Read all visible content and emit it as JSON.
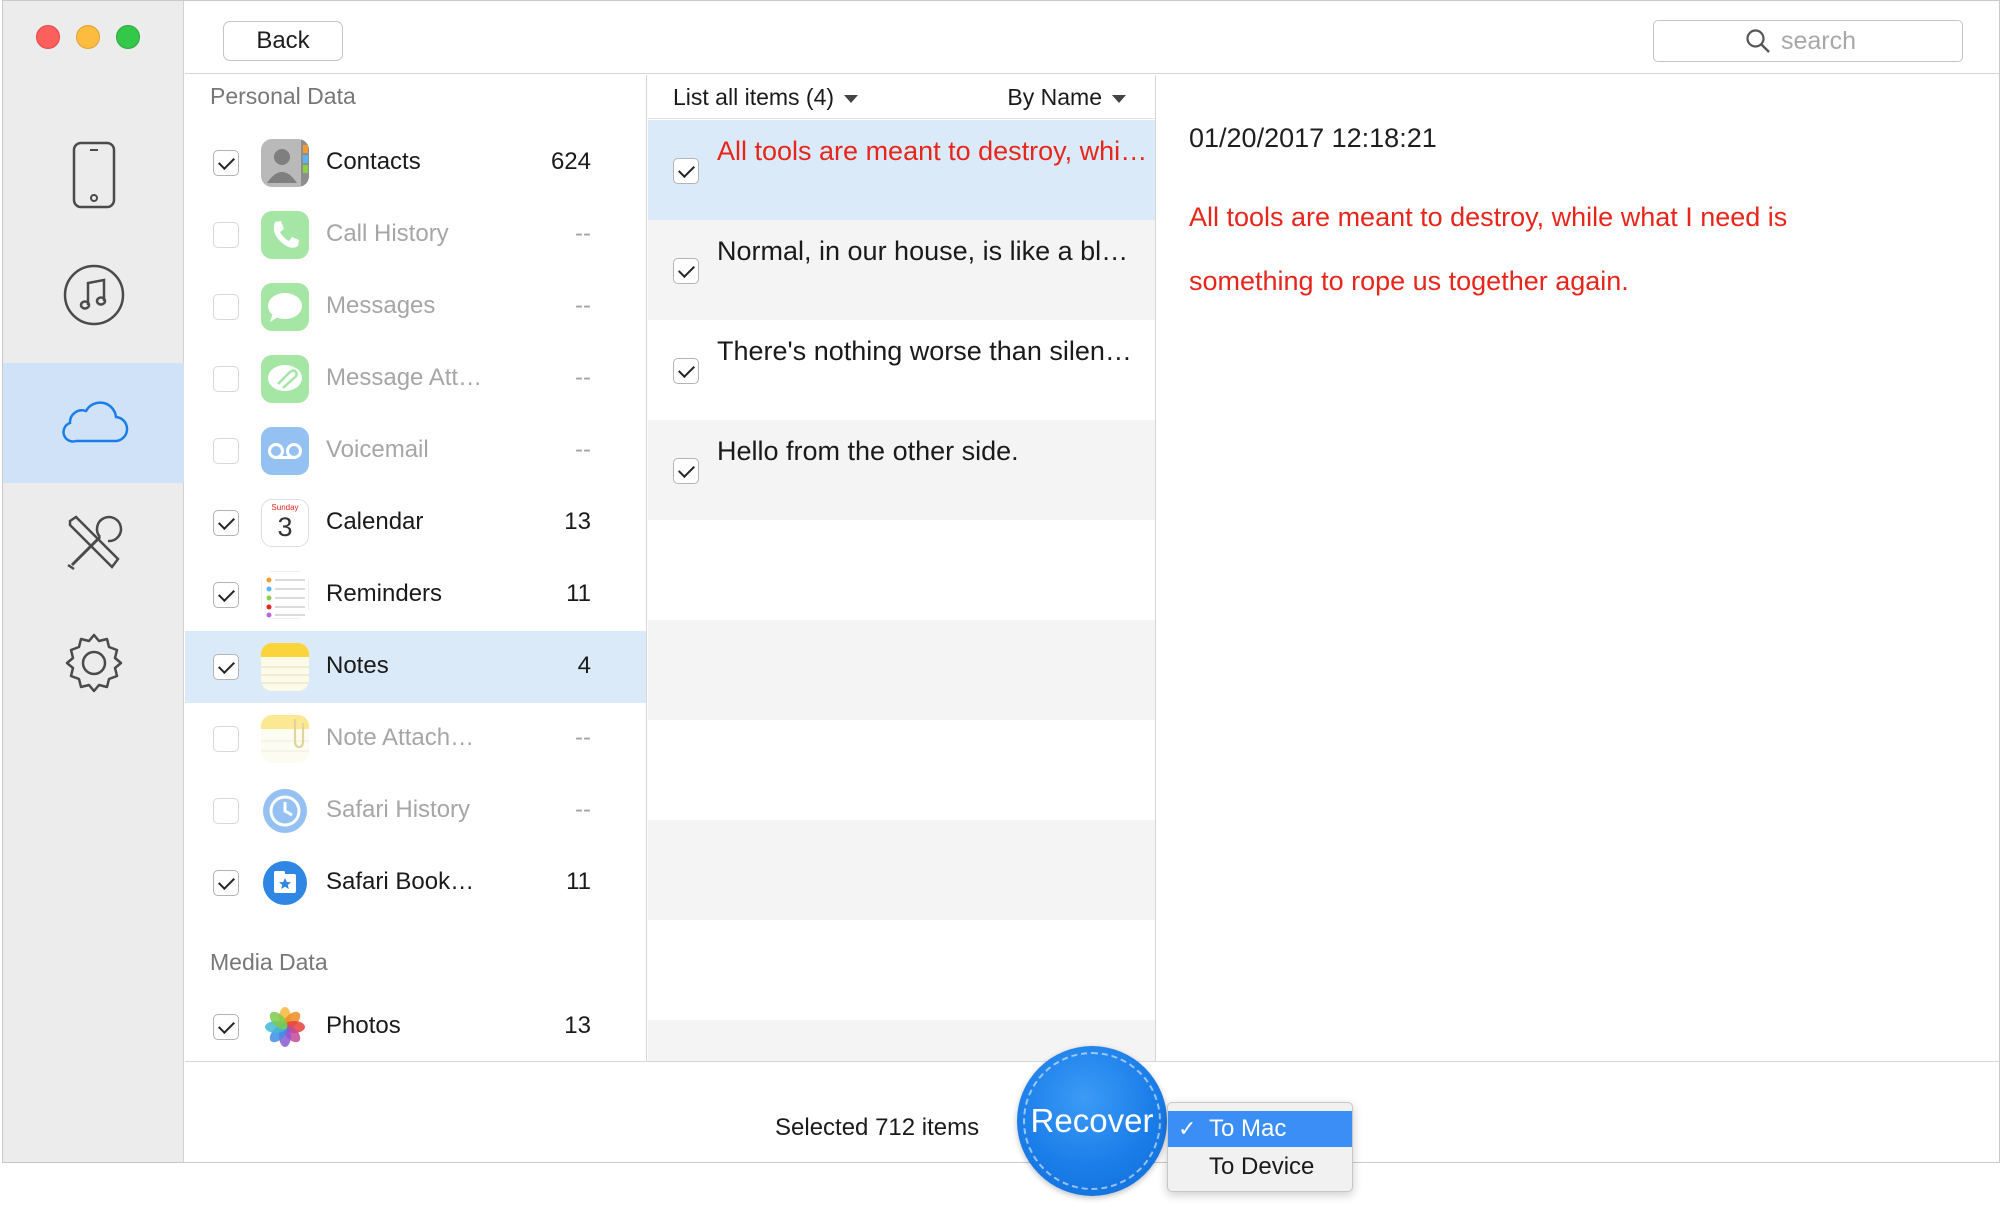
{
  "window": {
    "controls": [
      "close",
      "minimize",
      "zoom"
    ]
  },
  "rail": {
    "items": [
      {
        "icon": "iphone-icon",
        "active": false
      },
      {
        "icon": "music-note-icon",
        "active": false
      },
      {
        "icon": "cloud-icon",
        "active": true
      },
      {
        "icon": "tools-icon",
        "active": false
      },
      {
        "icon": "gear-icon",
        "active": false
      }
    ]
  },
  "toolbar": {
    "back_label": "Back",
    "search_placeholder": "search"
  },
  "categories": {
    "personal_title": "Personal Data",
    "media_title": "Media Data",
    "personal": [
      {
        "label": "Contacts",
        "count": "624",
        "checked": true,
        "icon": "contacts-icon"
      },
      {
        "label": "Call History",
        "count": "--",
        "checked": false,
        "icon": "phone-icon"
      },
      {
        "label": "Messages",
        "count": "--",
        "checked": false,
        "icon": "messages-icon"
      },
      {
        "label": "Message Att…",
        "count": "--",
        "checked": false,
        "icon": "message-attachment-icon"
      },
      {
        "label": "Voicemail",
        "count": "--",
        "checked": false,
        "icon": "voicemail-icon"
      },
      {
        "label": "Calendar",
        "count": "13",
        "checked": true,
        "icon": "calendar-icon",
        "calendar_day": "3",
        "calendar_weekday": "Sunday"
      },
      {
        "label": "Reminders",
        "count": "11",
        "checked": true,
        "icon": "reminders-icon"
      },
      {
        "label": "Notes",
        "count": "4",
        "checked": true,
        "icon": "notes-icon",
        "selected": true
      },
      {
        "label": "Note Attach…",
        "count": "--",
        "checked": false,
        "icon": "note-attachment-icon"
      },
      {
        "label": "Safari History",
        "count": "--",
        "checked": false,
        "icon": "safari-history-icon"
      },
      {
        "label": "Safari Book…",
        "count": "11",
        "checked": true,
        "icon": "safari-bookmark-icon"
      }
    ],
    "media": [
      {
        "label": "Photos",
        "count": "13",
        "checked": true,
        "icon": "photos-icon"
      }
    ]
  },
  "list": {
    "filter_label": "List all items (4)",
    "sort_label": "By Name",
    "items": [
      {
        "title": "All tools are meant to destroy, while what I need is something to rope us together again.",
        "checked": true,
        "selected": true
      },
      {
        "title": "Normal, in our house, is like a bl…",
        "checked": true,
        "selected": false
      },
      {
        "title": "There's nothing worse than silen…",
        "checked": true,
        "selected": false
      },
      {
        "title": "Hello from the other side.",
        "checked": true,
        "selected": false
      }
    ]
  },
  "detail": {
    "date": "01/20/2017 12:18:21",
    "body_line1": "All tools are meant to destroy, while what I need is",
    "body_line2": "something to rope us together again."
  },
  "footer": {
    "selected_text": "Selected 712 items",
    "recover_label": "Recover",
    "menu": [
      {
        "label": "To Mac",
        "checked": true
      },
      {
        "label": "To Device",
        "checked": false
      }
    ],
    "menu_check_glyph": "✓"
  },
  "colors": {
    "accent_blue": "#1a7de8",
    "selection_bg": "#dbeaf9",
    "highlight_red": "#e8251b",
    "menu_highlight": "#3a8ef5"
  }
}
